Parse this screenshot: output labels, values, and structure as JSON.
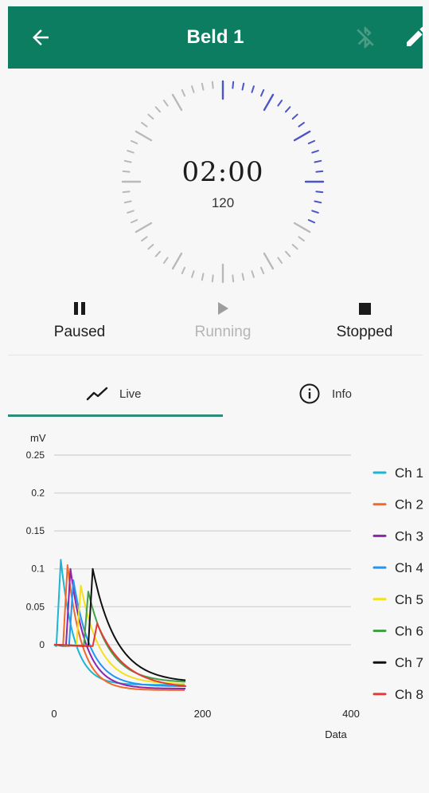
{
  "header": {
    "title": "Beld 1",
    "color": "#0d7d62"
  },
  "timer": {
    "time": "02:00",
    "seconds": "120",
    "progress_fraction": 0.33
  },
  "controls": [
    {
      "label": "Paused",
      "icon": "pause-icon",
      "state": "active"
    },
    {
      "label": "Running",
      "icon": "play-icon",
      "state": "disabled"
    },
    {
      "label": "Stopped",
      "icon": "stop-icon",
      "state": "active"
    }
  ],
  "tabs": [
    {
      "label": "Live",
      "icon": "trend-line-icon",
      "selected": true
    },
    {
      "label": "Info",
      "icon": "info-icon",
      "selected": false
    }
  ],
  "chart_data": {
    "type": "line",
    "ylabel": "mV",
    "xlabel": "Data",
    "ylim": [
      -0.06,
      0.25
    ],
    "xlim": [
      0,
      400
    ],
    "yticks": [
      "0.25",
      "0.2",
      "0.15",
      "0.1",
      "0.05",
      "0"
    ],
    "xticks": [
      "0",
      "200",
      "400"
    ],
    "legend_position": "right",
    "grid": true,
    "series": [
      {
        "name": "Ch 1",
        "color": "#1cb5d4",
        "start": 3,
        "peak_x": 9,
        "peak_y": 0.112,
        "end_y": -0.053
      },
      {
        "name": "Ch 2",
        "color": "#f06a2a",
        "start": 12,
        "peak_x": 18,
        "peak_y": 0.105,
        "end_y": -0.06
      },
      {
        "name": "Ch 3",
        "color": "#8e24aa",
        "start": 16,
        "peak_x": 22,
        "peak_y": 0.1,
        "end_y": -0.058
      },
      {
        "name": "Ch 4",
        "color": "#2196f3",
        "start": 20,
        "peak_x": 26,
        "peak_y": 0.085,
        "end_y": -0.055
      },
      {
        "name": "Ch 5",
        "color": "#f5e11b",
        "start": 30,
        "peak_x": 36,
        "peak_y": 0.078,
        "end_y": -0.052
      },
      {
        "name": "Ch 6",
        "color": "#43a047",
        "start": 40,
        "peak_x": 46,
        "peak_y": 0.07,
        "end_y": -0.05
      },
      {
        "name": "Ch 7",
        "color": "#111111",
        "start": 46,
        "peak_x": 52,
        "peak_y": 0.1,
        "end_y": -0.05
      },
      {
        "name": "Ch 8",
        "color": "#e53935",
        "start": 52,
        "peak_x": 58,
        "peak_y": 0.028,
        "end_y": -0.058
      }
    ]
  },
  "icons": {
    "back": "arrow-back-icon",
    "bluetooth": "bluetooth-disabled-icon",
    "edit": "pencil-icon"
  }
}
